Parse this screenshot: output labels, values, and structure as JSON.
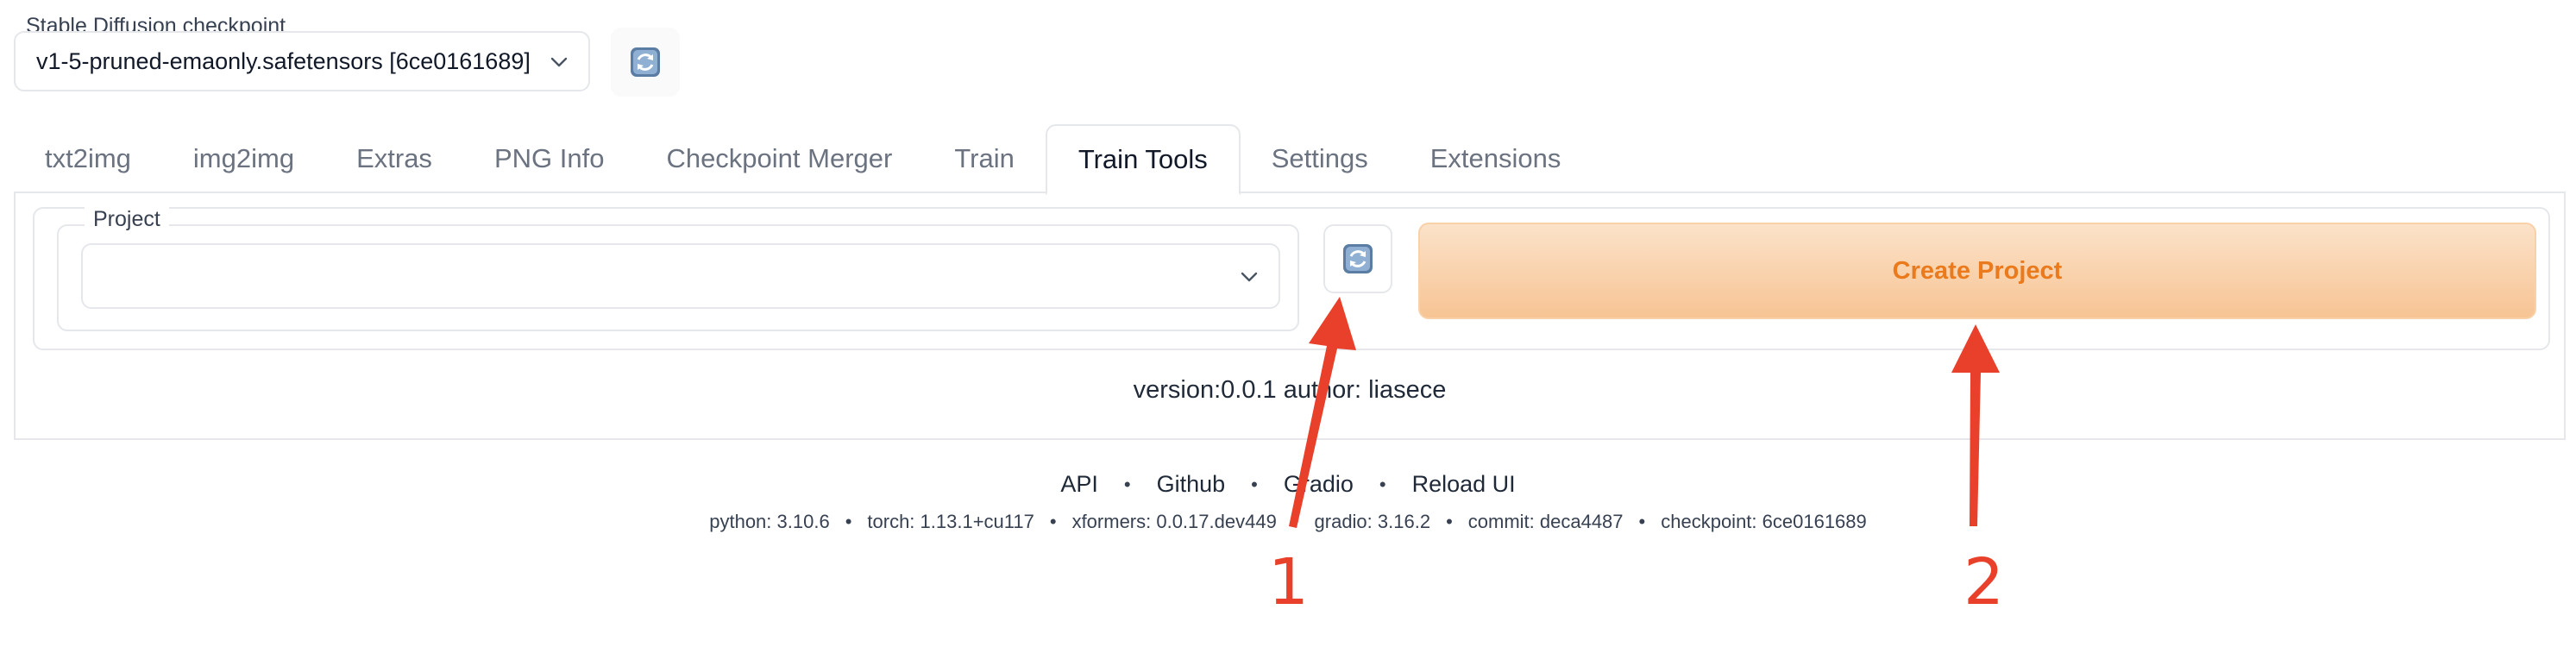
{
  "checkpoint": {
    "label": "Stable Diffusion checkpoint",
    "value": "v1-5-pruned-emaonly.safetensors [6ce0161689]"
  },
  "tabs": [
    {
      "label": "txt2img"
    },
    {
      "label": "img2img"
    },
    {
      "label": "Extras"
    },
    {
      "label": "PNG Info"
    },
    {
      "label": "Checkpoint Merger"
    },
    {
      "label": "Train"
    },
    {
      "label": "Train Tools",
      "active": true
    },
    {
      "label": "Settings"
    },
    {
      "label": "Extensions"
    }
  ],
  "panel": {
    "project_label": "Project",
    "project_value": "",
    "create_button": "Create Project",
    "version_text": "version:0.0.1 author: liasece"
  },
  "footer": {
    "links": [
      "API",
      "Github",
      "Gradio",
      "Reload UI"
    ],
    "separator": "•",
    "meta": [
      "python: 3.10.6",
      "torch: 1.13.1+cu117",
      "xformers: 0.0.17.dev449",
      "gradio: 3.16.2",
      "commit: deca4487",
      "checkpoint: 6ce0161689"
    ]
  },
  "annotations": {
    "marker_1": "1",
    "marker_2": "2",
    "color": "#e8402a"
  },
  "icons": {
    "refresh": "refresh-icon",
    "chevron": "chevron-down-icon"
  }
}
